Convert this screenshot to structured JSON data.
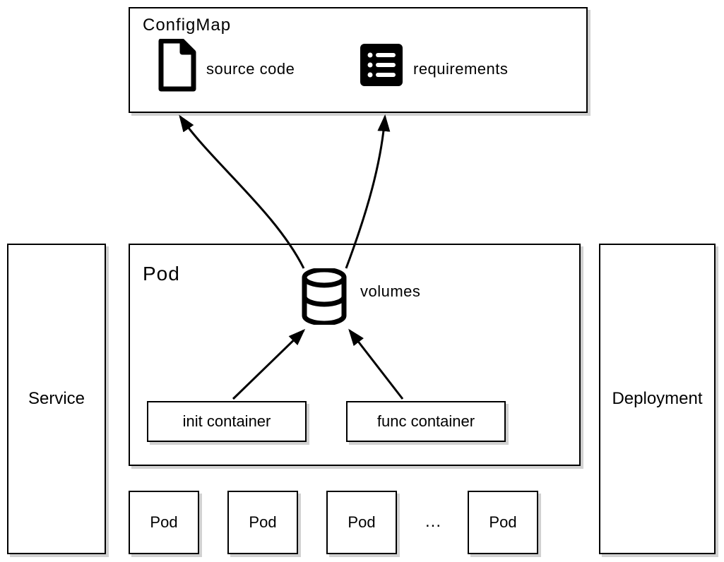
{
  "configmap": {
    "title": "ConfigMap",
    "source_label": "source code",
    "requirements_label": "requirements"
  },
  "pod": {
    "title": "Pod",
    "volumes_label": "volumes",
    "init_container_label": "init container",
    "func_container_label": "func container"
  },
  "service": {
    "title": "Service"
  },
  "deployment": {
    "title": "Deployment"
  },
  "pod_row": {
    "items": [
      "Pod",
      "Pod",
      "Pod",
      "Pod"
    ],
    "ellipsis": "..."
  }
}
